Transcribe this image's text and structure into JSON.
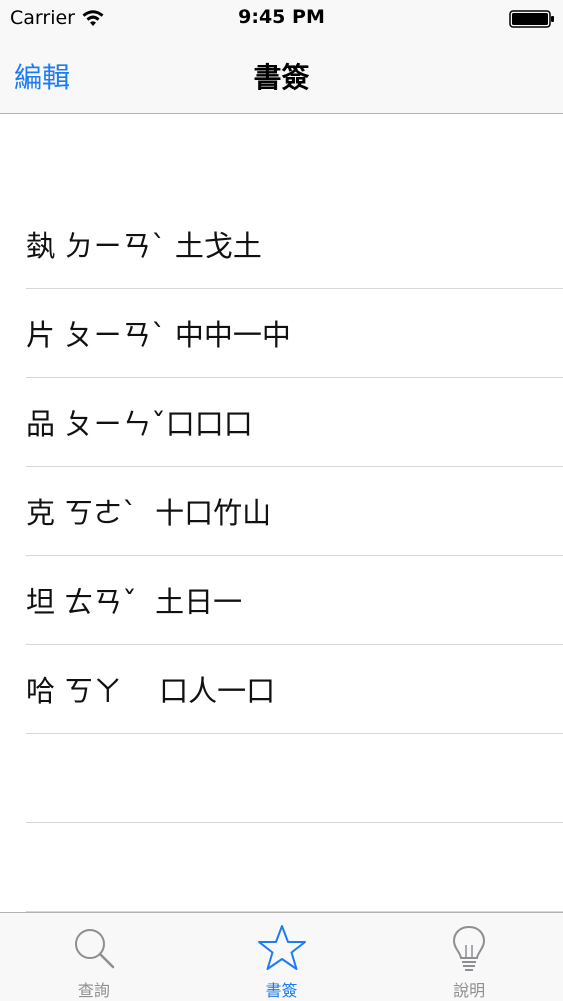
{
  "status_bar": {
    "carrier": "Carrier",
    "time": "9:45 PM"
  },
  "nav": {
    "edit_label": "編輯",
    "title": "書簽"
  },
  "bookmarks": [
    {
      "text": "埶 ㄉㄧㄢˋ 土戈土"
    },
    {
      "text": "片 ㄆㄧㄢˋ 中中一中"
    },
    {
      "text": "品 ㄆㄧㄣˇ口口口"
    },
    {
      "text": "克 ㄎㄜˋ  十口竹山"
    },
    {
      "text": "坦 ㄊㄢˇ  土日一"
    },
    {
      "text": "哈 ㄎㄚ    口人一口"
    }
  ],
  "tabs": [
    {
      "label": "查詢",
      "icon": "search-icon",
      "active": false
    },
    {
      "label": "書簽",
      "icon": "star-icon",
      "active": true
    },
    {
      "label": "說明",
      "icon": "lightbulb-icon",
      "active": false
    }
  ],
  "colors": {
    "accent": "#1b7cf3",
    "inactive": "#8e8e93",
    "separator": "#d6d6d6"
  }
}
